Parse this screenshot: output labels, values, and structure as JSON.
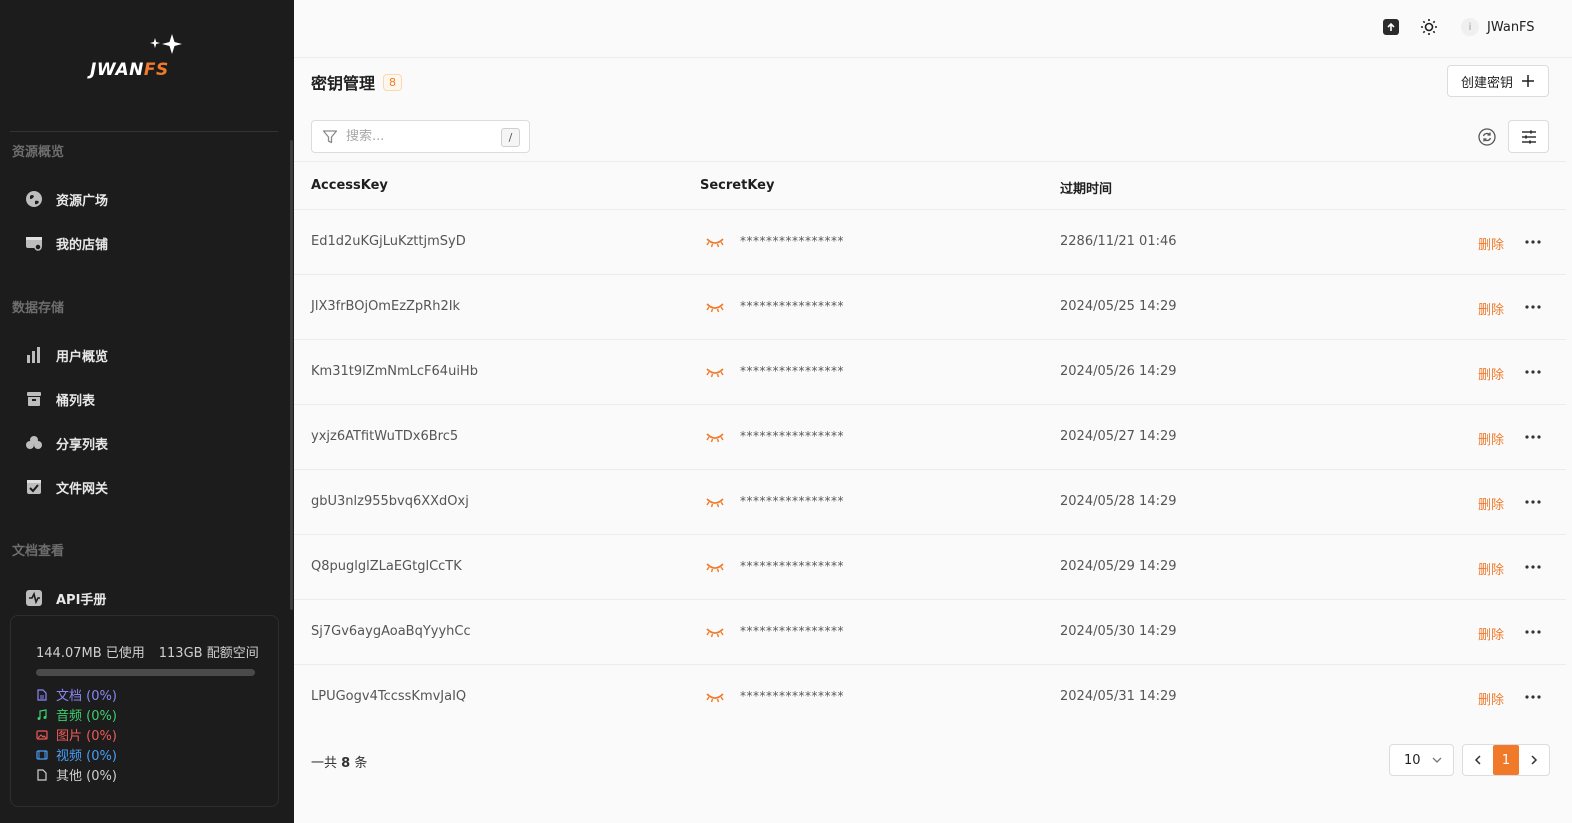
{
  "brand": {
    "logo_main": "JWAN",
    "logo_accent": "FS",
    "accent_color": "#f07a2a"
  },
  "sidebar": {
    "sections": [
      {
        "label": "资源概览",
        "items": [
          {
            "label": "资源广场",
            "icon": "globe-icon"
          },
          {
            "label": "我的店铺",
            "icon": "store-icon"
          }
        ]
      },
      {
        "label": "数据存储",
        "items": [
          {
            "label": "用户概览",
            "icon": "bar-chart-icon"
          },
          {
            "label": "桶列表",
            "icon": "bucket-icon"
          },
          {
            "label": "分享列表",
            "icon": "cloud-share-icon"
          },
          {
            "label": "文件网关",
            "icon": "gateway-icon"
          }
        ]
      },
      {
        "label": "文档查看",
        "items": [
          {
            "label": "API手册",
            "icon": "api-book-icon"
          }
        ]
      }
    ],
    "storage": {
      "used": "144.07MB 已使用",
      "quota": "113GB 配额空间",
      "used_fraction": 0.001,
      "legend": [
        {
          "label": "文档 (0%)",
          "color": "#8b86f5",
          "icon": "document-icon"
        },
        {
          "label": "音频 (0%)",
          "color": "#3ccf6e",
          "icon": "music-icon"
        },
        {
          "label": "图片 (0%)",
          "color": "#ef5a5a",
          "icon": "image-icon"
        },
        {
          "label": "视频 (0%)",
          "color": "#4a9df5",
          "icon": "video-icon"
        },
        {
          "label": "其他 (0%)",
          "color": "#cfcfcf",
          "icon": "file-icon"
        }
      ]
    }
  },
  "header": {
    "username": "JWanFS",
    "info_glyph": "i"
  },
  "main": {
    "title": "密钥管理",
    "count": "8",
    "create_label": "创建密钥",
    "search": {
      "placeholder": "搜索...",
      "shortcut": "/"
    },
    "columns": [
      "AccessKey",
      "SecretKey",
      "过期时间"
    ],
    "rows": [
      {
        "access_key": "Ed1d2uKGjLuKzttjmSyD",
        "secret": "****************",
        "expires": "2286/11/21 01:46",
        "action": "删除"
      },
      {
        "access_key": "JlX3frBOjOmEzZpRh2Ik",
        "secret": "****************",
        "expires": "2024/05/25 14:29",
        "action": "删除"
      },
      {
        "access_key": "Km31t9lZmNmLcF64uiHb",
        "secret": "****************",
        "expires": "2024/05/26 14:29",
        "action": "删除"
      },
      {
        "access_key": "yxjz6ATfitWuTDx6Brc5",
        "secret": "****************",
        "expires": "2024/05/27 14:29",
        "action": "删除"
      },
      {
        "access_key": "gbU3nlz955bvq6XXdOxj",
        "secret": "****************",
        "expires": "2024/05/28 14:29",
        "action": "删除"
      },
      {
        "access_key": "Q8puglglZLaEGtglCcTK",
        "secret": "****************",
        "expires": "2024/05/29 14:29",
        "action": "删除"
      },
      {
        "access_key": "Sj7Gv6aygAoaBqYyyhCc",
        "secret": "****************",
        "expires": "2024/05/30 14:29",
        "action": "删除"
      },
      {
        "access_key": "LPUGogv4TccssKmvJaIQ",
        "secret": "****************",
        "expires": "2024/05/31 14:29",
        "action": "删除"
      }
    ],
    "footer": {
      "total_prefix": "一共",
      "total_count": "8",
      "total_suffix": "条",
      "page_size": "10",
      "current_page": "1"
    }
  }
}
